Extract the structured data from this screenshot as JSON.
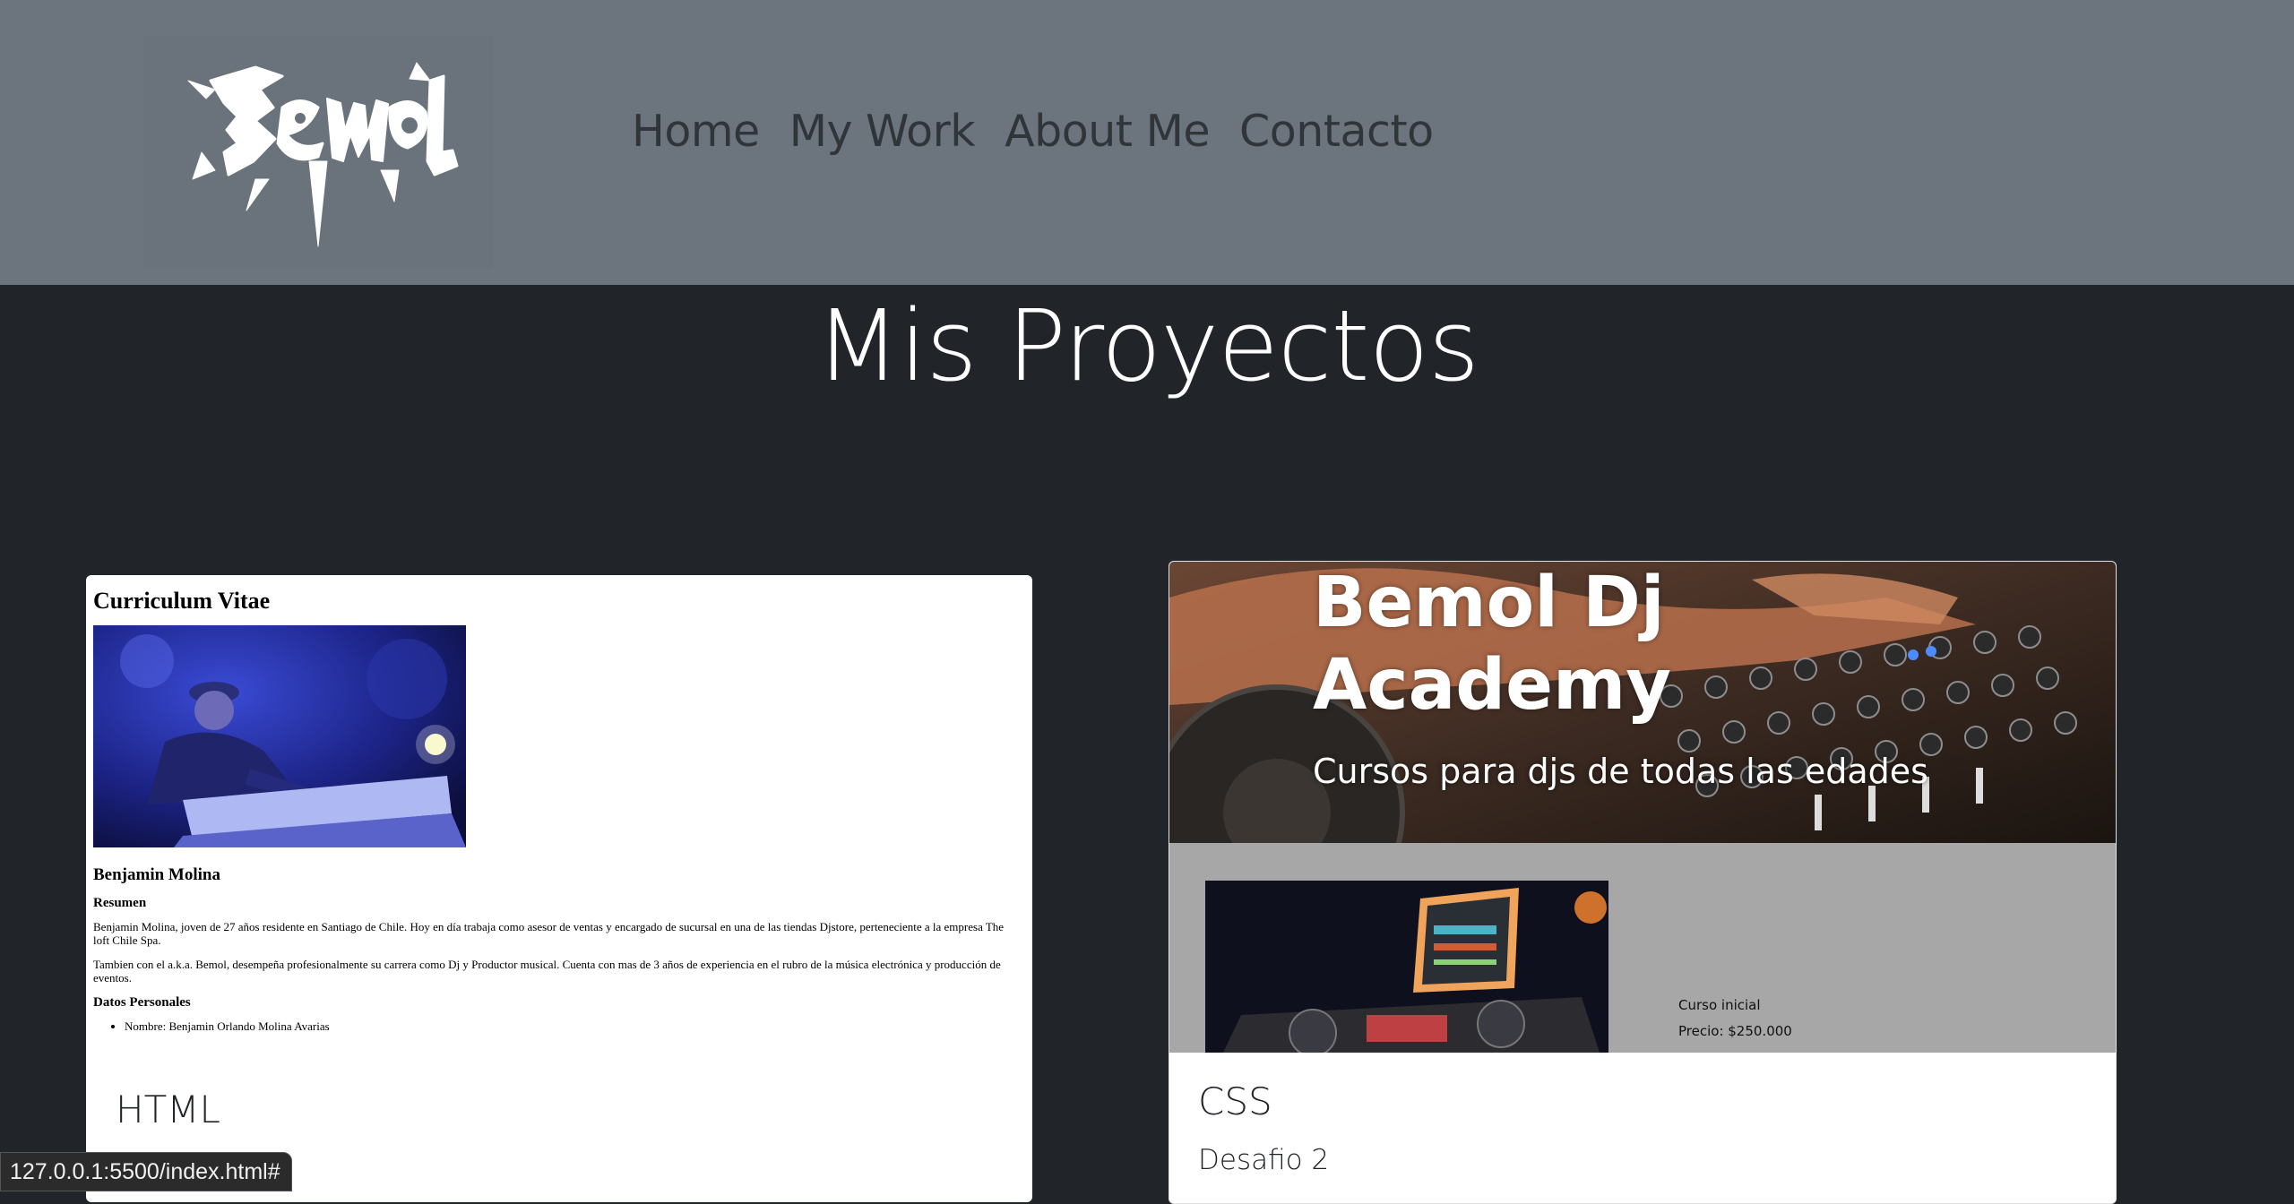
{
  "header": {
    "logo_alt": "Bemol logo",
    "nav": [
      {
        "label": "Home"
      },
      {
        "label": "My Work"
      },
      {
        "label": "About Me"
      },
      {
        "label": "Contacto"
      }
    ]
  },
  "page_title": "Mis Proyectos",
  "projects": [
    {
      "title": "HTML",
      "preview": {
        "heading": "Curriculum Vitae",
        "name": "Benjamin Molina",
        "resumen_heading": "Resumen",
        "paragraph_1": "Benjamin Molina, joven de 27 años residente en Santiago de Chile. Hoy en día trabaja como asesor de ventas y encargado de sucursal en una de las tiendas Djstore, perteneciente a la empresa The loft Chile Spa.",
        "paragraph_2": "Tambien con el a.k.a. Bemol, desempeña profesionalmente su carrera como Dj y Productor musical. Cuenta con mas de 3 años de experiencia en el rubro de la música electrónica y producción de eventos.",
        "datos_heading": "Datos Personales",
        "datos": [
          "Nombre: Benjamin Orlando Molina Avarias"
        ]
      }
    },
    {
      "title": "CSS",
      "subtitle": "Desafio 2",
      "preview": {
        "hero_title": "Bemol Dj Academy",
        "hero_subtitle": "Cursos para djs de todas las edades",
        "course_name": "Curso inicial",
        "course_price": "Precio: $250.000"
      }
    }
  ],
  "status_url": "127.0.0.1:5500/index.html#",
  "colors": {
    "navbar": "#6c757d",
    "background": "#212529",
    "nav_text": "#30353a",
    "course_strip": "#a7a7a7"
  }
}
